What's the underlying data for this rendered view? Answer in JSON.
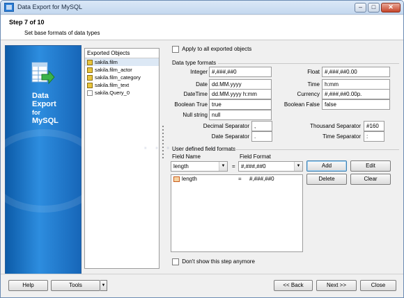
{
  "window": {
    "title": "Data Export for MySQL"
  },
  "header": {
    "step": "Step 7 of 10",
    "subtitle": "Set base formats of data types"
  },
  "branding": {
    "line1": "Data",
    "line2": "Export",
    "line3": "for",
    "line4": "MySQL"
  },
  "tree": {
    "header": "Exported Objects",
    "items": [
      {
        "label": "sakila.film",
        "icon": "table-icon"
      },
      {
        "label": "sakila.film_actor",
        "icon": "table-icon"
      },
      {
        "label": "sakila.film_category",
        "icon": "table-icon"
      },
      {
        "label": "sakila.film_text",
        "icon": "table-icon"
      },
      {
        "label": "sakila.Query_0",
        "icon": "query-icon"
      }
    ]
  },
  "apply_all": {
    "label": "Apply to all exported objects",
    "checked": false
  },
  "formats": {
    "group_title": "Data type formats",
    "integer": {
      "label": "Integer",
      "value": "#,###,##0"
    },
    "float": {
      "label": "Float",
      "value": "#,###,##0.00"
    },
    "date": {
      "label": "Date",
      "value": "dd.MM.yyyy"
    },
    "time": {
      "label": "Time",
      "value": "h:mm"
    },
    "datetime": {
      "label": "DateTime",
      "value": "dd.MM.yyyy h:mm"
    },
    "currency": {
      "label": "Currency",
      "value": "#,###,##0.00p."
    },
    "boolean_true": {
      "label": "Boolean True",
      "value": "true"
    },
    "boolean_false": {
      "label": "Boolean False",
      "value": "false"
    },
    "null_string": {
      "label": "Null string",
      "value": "null"
    },
    "decimal_sep": {
      "label": "Decimal Separator",
      "value": ","
    },
    "thousand_sep": {
      "label": "Thousand Separator",
      "value": "#160"
    },
    "date_sep": {
      "label": "Date Separator",
      "value": "."
    },
    "time_sep": {
      "label": "Time Separator",
      "value": ":"
    }
  },
  "user_formats": {
    "group_title": "User defined field formats",
    "field_name_label": "Field Name",
    "field_format_label": "Field Format",
    "field_name_value": "length",
    "equals": "=",
    "field_format_value": "#,###,##0",
    "buttons": {
      "add": "Add",
      "edit": "Edit",
      "delete": "Delete",
      "clear": "Clear"
    },
    "rows": [
      {
        "name": "length",
        "eq": "=",
        "format": "#,###,##0"
      }
    ]
  },
  "dont_show": {
    "label": "Don't show this step anymore",
    "checked": false
  },
  "footer": {
    "help": "Help",
    "tools": "Tools",
    "back": "<< Back",
    "next": "Next >>",
    "close": "Close"
  }
}
